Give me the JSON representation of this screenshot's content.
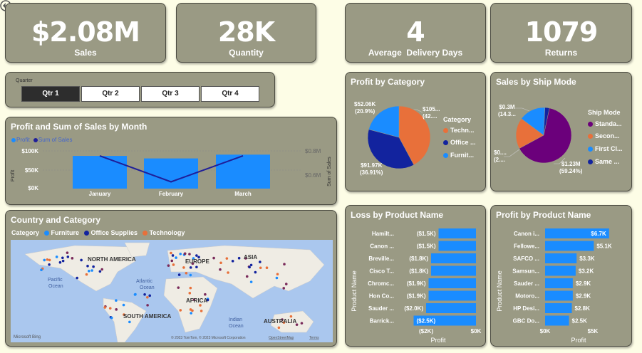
{
  "colors": {
    "card_bg": "#9a9a84",
    "page_bg": "#fdfde6",
    "bar_blue": "#1a8cff",
    "line_navy": "#1f1f99",
    "orange": "#e8703a",
    "purple": "#6b007b",
    "dark_blue": "#12239e",
    "map_water": "#aac7ee"
  },
  "kpis": [
    {
      "value": "$2.08M",
      "label": "Sales"
    },
    {
      "value": "28K",
      "label": "Quantity"
    },
    {
      "value": "4",
      "label": "Average  Delivery Days"
    },
    {
      "value": "1079",
      "label": "Returns"
    }
  ],
  "quarter_slicer": {
    "title": "Quarter",
    "options": [
      "Qtr 1",
      "Qtr 2",
      "Qtr 3",
      "Qtr 4"
    ],
    "selected": "Qtr 1"
  },
  "profit_sales_chart": {
    "title": "Profit and Sum of Sales by Month",
    "legend": [
      "Profit",
      "Sum of Sales"
    ],
    "y_left_ticks": [
      "$100K",
      "$50K",
      "$0K"
    ],
    "y_right_ticks": [
      "$0.8M",
      "$0.6M"
    ],
    "y_left_label": "Profit",
    "y_right_label": "Sum of Sales",
    "months": [
      "January",
      "February",
      "March"
    ]
  },
  "profit_by_category": {
    "title": "Profit by Category",
    "legend_title": "Category",
    "legend_items": [
      "Techn...",
      "Office ...",
      "Furnit..."
    ],
    "labels": [
      {
        "line1": "$52.06K",
        "line2": "(20.9%)"
      },
      {
        "line1": "$105...",
        "line2": "(42...."
      },
      {
        "line1": "$91.97K",
        "line2": "(36.91%)"
      }
    ]
  },
  "sales_by_ship_mode": {
    "title": "Sales by Ship Mode",
    "legend_title": "Ship Mode",
    "legend_items": [
      "Standa...",
      "Secon...",
      "First Cl...",
      "Same ..."
    ],
    "labels": [
      {
        "line1": "$0.3M",
        "line2": "(14.3..."
      },
      {
        "line1": "$0....",
        "line2": "(2...."
      },
      {
        "line1": "$1.23M",
        "line2": "(59.24%)"
      }
    ]
  },
  "country_category": {
    "title": "Country and Category",
    "legend_title": "Category",
    "legend_items": [
      "Furniture",
      "Office Supplies",
      "Technology"
    ],
    "map_labels": [
      "NORTH AMERICA",
      "EUROPE",
      "ASIA",
      "Atlantic",
      "Ocean",
      "Pacific",
      "Ocean",
      "AFRICA",
      "SOUTH AMERICA",
      "Indian",
      "Ocean",
      "AUSTRALIA"
    ],
    "attribution": "© 2023 TomTom, © 2023 Microsoft Corporation",
    "attribution_link": "OpenStreetMap",
    "terms": "Terms",
    "bing": "Microsoft Bing"
  },
  "loss_by_product": {
    "title": "Loss by Product Name",
    "y_axis_title": "Product Name",
    "x_axis_title": "Profit",
    "x_ticks": [
      "($2K)",
      "$0K"
    ],
    "items": [
      {
        "name": "Hamilt...",
        "label": "($1.5K)"
      },
      {
        "name": "Canon ...",
        "label": "($1.5K)"
      },
      {
        "name": "Breville...",
        "label": "($1.8K)"
      },
      {
        "name": "Cisco T...",
        "label": "($1.8K)"
      },
      {
        "name": "Chromc...",
        "label": "($1.9K)"
      },
      {
        "name": "Hon Co...",
        "label": "($1.9K)"
      },
      {
        "name": "Sauder ...",
        "label": "($2.0K)"
      },
      {
        "name": "Barrick...",
        "label": "($2.5K)"
      }
    ]
  },
  "profit_by_product": {
    "title": "Profit by Product Name",
    "y_axis_title": "Product Name",
    "x_axis_title": "Profit",
    "x_ticks": [
      "$0K",
      "$5K"
    ],
    "items": [
      {
        "name": "Canon i...",
        "label": "$6.7K"
      },
      {
        "name": "Fellowe...",
        "label": "$5.1K"
      },
      {
        "name": "SAFCO ...",
        "label": "$3.3K"
      },
      {
        "name": "Samsun...",
        "label": "$3.2K"
      },
      {
        "name": "Sauder ...",
        "label": "$2.9K"
      },
      {
        "name": "Motoro...",
        "label": "$2.9K"
      },
      {
        "name": "HP Desi...",
        "label": "$2.8K"
      },
      {
        "name": "GBC Do...",
        "label": "$2.5K"
      }
    ]
  },
  "chart_data": [
    {
      "type": "bar",
      "title": "Profit and Sum of Sales by Month",
      "categories": [
        "January",
        "February",
        "March"
      ],
      "series": [
        {
          "name": "Sum of Sales",
          "type": "bar",
          "values": [
            0.76,
            0.74,
            0.77
          ]
        },
        {
          "name": "Profit",
          "type": "line",
          "values": [
            87000,
            18000,
            87000
          ]
        }
      ],
      "ylabel": "Profit",
      "y2label": "Sum of Sales",
      "ylim": [
        0,
        100000
      ]
    },
    {
      "type": "pie",
      "title": "Profit by Category",
      "categories": [
        "Technology",
        "Office Supplies",
        "Furniture"
      ],
      "values": [
        105000,
        91970,
        52060
      ],
      "percents": [
        42.19,
        36.91,
        20.9
      ]
    },
    {
      "type": "pie",
      "title": "Sales by Ship Mode",
      "categories": [
        "Standard Class",
        "Second Class",
        "First Class",
        "Same Day"
      ],
      "values": [
        1.23,
        0.35,
        0.3,
        0.05
      ],
      "percents": [
        59.24,
        21.0,
        14.3,
        2.5
      ]
    },
    {
      "type": "bar",
      "title": "Loss by Product Name",
      "categories": [
        "Hamilt...",
        "Canon ...",
        "Breville...",
        "Cisco T...",
        "Chromc...",
        "Hon Co...",
        "Sauder ...",
        "Barrick..."
      ],
      "values": [
        -1.5,
        -1.5,
        -1.8,
        -1.8,
        -1.9,
        -1.9,
        -2.0,
        -2.5
      ],
      "xlabel": "Profit",
      "ylabel": "Product Name",
      "xlim": [
        -2.5,
        0
      ]
    },
    {
      "type": "bar",
      "title": "Profit by Product Name",
      "categories": [
        "Canon i...",
        "Fellowe...",
        "SAFCO ...",
        "Samsun...",
        "Sauder ...",
        "Motoro...",
        "HP Desi...",
        "GBC Do..."
      ],
      "values": [
        6.7,
        5.1,
        3.3,
        3.2,
        2.9,
        2.9,
        2.8,
        2.5
      ],
      "xlabel": "Profit",
      "ylabel": "Product Name",
      "xlim": [
        0,
        7
      ]
    }
  ]
}
